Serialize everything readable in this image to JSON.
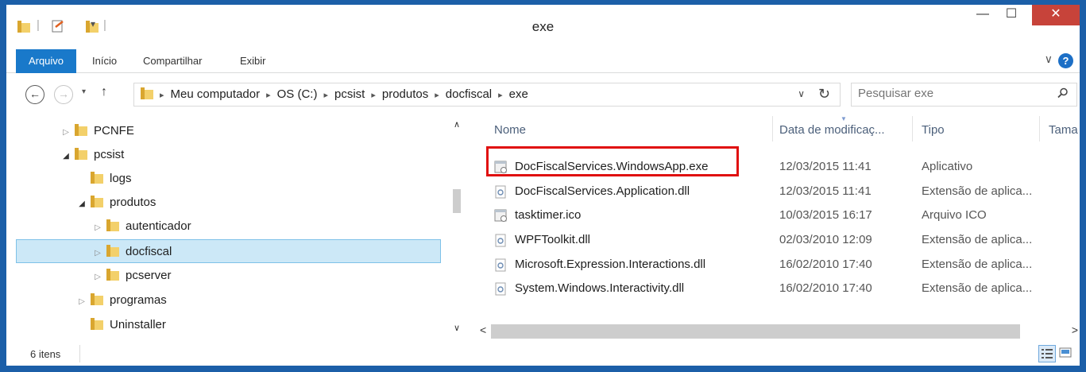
{
  "window": {
    "title": "exe",
    "minimize_label": "—",
    "maximize_label": "☐",
    "close_label": "✕"
  },
  "quick_access": {
    "divider": "|",
    "dropdown": "▾"
  },
  "ribbon": {
    "tabs": [
      "Arquivo",
      "Início",
      "Compartilhar",
      "Exibir"
    ],
    "expand_label": "∨",
    "help_label": "?"
  },
  "nav": {
    "back_label": "←",
    "forward_label": "→",
    "recent_label": "▾",
    "up_label": "↑",
    "dropdown_label": "∨",
    "refresh_label": "↻",
    "breadcrumb": [
      "Meu computador",
      "OS (C:)",
      "pcsist",
      "produtos",
      "docfiscal",
      "exe"
    ],
    "separator": "▸",
    "search_placeholder": "Pesquisar exe"
  },
  "tree": {
    "items": [
      {
        "label": "PCNFE",
        "expander": "▷"
      },
      {
        "label": "pcsist",
        "expander": "◢"
      },
      {
        "label": "logs",
        "expander": ""
      },
      {
        "label": "produtos",
        "expander": "◢"
      },
      {
        "label": "autenticador",
        "expander": "▷"
      },
      {
        "label": "docfiscal",
        "expander": "▷"
      },
      {
        "label": "pcserver",
        "expander": "▷"
      },
      {
        "label": "programas",
        "expander": "▷"
      },
      {
        "label": "Uninstaller",
        "expander": ""
      }
    ],
    "scroll_up": "∧",
    "scroll_down": "∨"
  },
  "files": {
    "columns": [
      "Nome",
      "Data de modificaç...",
      "Tipo",
      "Tama"
    ],
    "rows": [
      {
        "name": "DocFiscalServices.WindowsApp.exe",
        "date": "12/03/2015 11:41",
        "type": "Aplicativo",
        "icon": "exe-icon"
      },
      {
        "name": "DocFiscalServices.Application.dll",
        "date": "12/03/2015 11:41",
        "type": "Extensão de aplica...",
        "icon": "dll-icon"
      },
      {
        "name": "tasktimer.ico",
        "date": "10/03/2015 16:17",
        "type": "Arquivo ICO",
        "icon": "ico-icon"
      },
      {
        "name": "WPFToolkit.dll",
        "date": "02/03/2010 12:09",
        "type": "Extensão de aplica...",
        "icon": "dll-icon"
      },
      {
        "name": "Microsoft.Expression.Interactions.dll",
        "date": "16/02/2010 17:40",
        "type": "Extensão de aplica...",
        "icon": "dll-icon"
      },
      {
        "name": "System.Windows.Interactivity.dll",
        "date": "16/02/2010 17:40",
        "type": "Extensão de aplica...",
        "icon": "dll-icon"
      }
    ],
    "scroll_left": "<",
    "scroll_right": ">"
  },
  "status": {
    "text": "6 itens"
  },
  "colors": {
    "frame": "#1c5fa8",
    "accent": "#1979ca",
    "close": "#c7433a",
    "selection": "#cce8f7",
    "highlight": "#e01010"
  }
}
